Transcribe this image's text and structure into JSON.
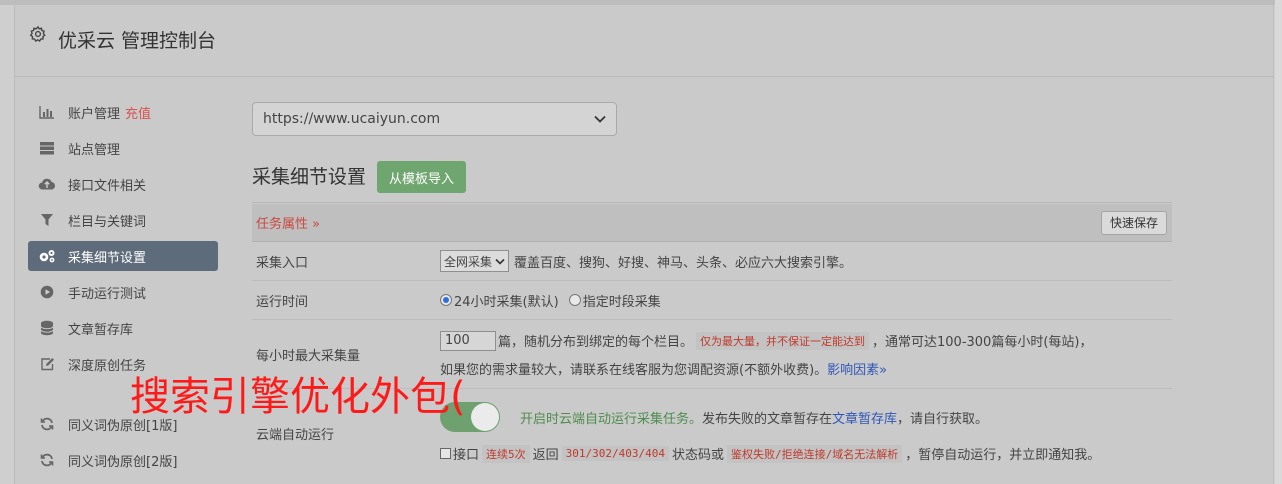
{
  "header": {
    "title": "优采云 管理控制台",
    "icon": "gear-icon"
  },
  "sidebar": {
    "items": [
      {
        "label": "账户管理",
        "extra": "充值",
        "icon": "bar-chart-icon"
      },
      {
        "label": "站点管理",
        "icon": "server-icon"
      },
      {
        "label": "接口文件相关",
        "icon": "cloud-upload-icon"
      },
      {
        "label": "栏目与关键词",
        "icon": "filter-icon"
      },
      {
        "label": "采集细节设置",
        "icon": "cogs-icon",
        "active": true
      },
      {
        "label": "手动运行测试",
        "icon": "play-circle-icon"
      },
      {
        "label": "文章暂存库",
        "icon": "database-icon"
      },
      {
        "label": "深度原创任务",
        "icon": "edit-icon"
      },
      {
        "label": "同义词伪原创[1版]",
        "icon": "refresh-icon"
      },
      {
        "label": "同义词伪原创[2版]",
        "icon": "refresh-icon"
      }
    ]
  },
  "site_select": {
    "value": "https://www.ucaiyun.com"
  },
  "section": {
    "title": "采集细节设置",
    "import_button": "从模板导入"
  },
  "table": {
    "header": {
      "label": "任务属性 »",
      "save_button": "快速保存"
    },
    "rows": {
      "entry": {
        "label": "采集入口",
        "select": "全网采集",
        "desc": "覆盖百度、搜狗、好搜、神马、头条、必应六大搜索引擎。"
      },
      "time": {
        "label": "运行时间",
        "option1": "24小时采集(默认)",
        "option2": "指定时段采集"
      },
      "max": {
        "label": "每小时最大采集量",
        "value": "100",
        "text1": "篇，随机分布到绑定的每个栏目。",
        "highlight": "仅为最大量，并不保证一定能达到",
        "text2": "，通常可达100-300篇每小时(每站)，",
        "text3": "如果您的需求量较大，请联系在线客服为您调配资源(不额外收费)。",
        "link": "影响因素»"
      },
      "cloud": {
        "label": "云端自动运行",
        "green_text": "开启时云端自动运行采集任务。",
        "text1": "发布失败的文章暂存在",
        "link": "文章暂存库",
        "text2": "，请自行获取。",
        "check_label": "接口",
        "hl1": "连续5次",
        "text3": "返回",
        "hl2": "301/302/403/404",
        "text4": "状态码或",
        "hl3": "鉴权失败/拒绝连接/域名无法解析",
        "text5": "，暂停自动运行，并立即通知我。"
      }
    }
  },
  "watermark": "搜索引擎优化外包("
}
